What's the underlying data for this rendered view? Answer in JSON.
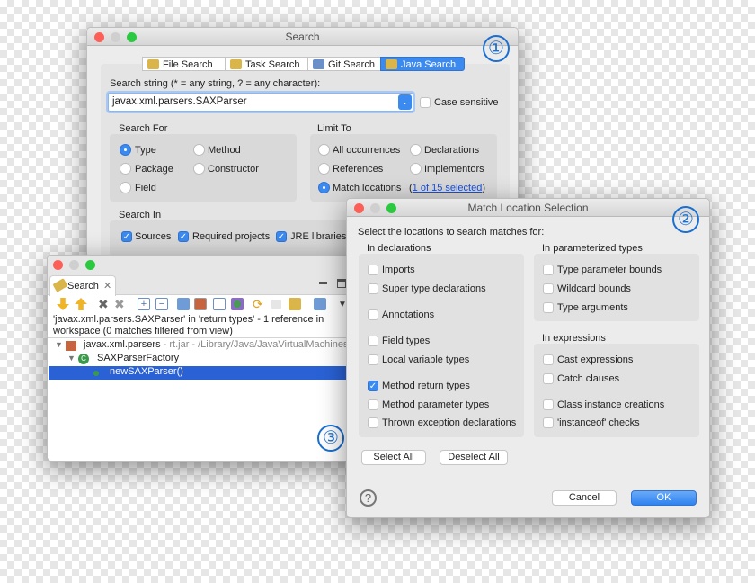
{
  "search_dialog": {
    "title": "Search",
    "badge": "①",
    "tabs": [
      {
        "label": "File Search"
      },
      {
        "label": "Task Search"
      },
      {
        "label": "Git Search"
      },
      {
        "label": "Java Search",
        "active": true
      }
    ],
    "search_string_label": "Search string (* = any string, ? = any character):",
    "search_string_value": "javax.xml.parsers.SAXParser",
    "case_sensitive_label": "Case sensitive",
    "case_sensitive": false,
    "search_for": {
      "label": "Search For",
      "options": [
        "Type",
        "Method",
        "Package",
        "Constructor",
        "Field"
      ],
      "selected": "Type"
    },
    "limit_to": {
      "label": "Limit To",
      "options": [
        "All occurrences",
        "Declarations",
        "References",
        "Implementors",
        "Match locations"
      ],
      "selected": "Match locations",
      "link_open": "(",
      "link": "1 of 15 selected",
      "link_close": ")"
    },
    "search_in": {
      "label": "Search In",
      "options": [
        {
          "label": "Sources",
          "checked": true
        },
        {
          "label": "Required projects",
          "checked": true
        },
        {
          "label": "JRE libraries",
          "checked": true
        }
      ]
    }
  },
  "match_dialog": {
    "title": "Match Location Selection",
    "badge": "②",
    "instruction": "Select the locations to search matches for:",
    "in_declarations": {
      "label": "In declarations",
      "items": [
        {
          "label": "Imports",
          "checked": false
        },
        {
          "label": "Super type declarations",
          "checked": false
        },
        {
          "label": "Annotations",
          "checked": false
        },
        {
          "label": "Field types",
          "checked": false
        },
        {
          "label": "Local variable types",
          "checked": false
        },
        {
          "label": "Method return types",
          "checked": true
        },
        {
          "label": "Method parameter types",
          "checked": false
        },
        {
          "label": "Thrown exception declarations",
          "checked": false
        }
      ]
    },
    "in_parameterized_types": {
      "label": "In parameterized types",
      "items": [
        {
          "label": "Type parameter bounds",
          "checked": false
        },
        {
          "label": "Wildcard bounds",
          "checked": false
        },
        {
          "label": "Type arguments",
          "checked": false
        }
      ]
    },
    "in_expressions": {
      "label": "In expressions",
      "items": [
        {
          "label": "Cast expressions",
          "checked": false
        },
        {
          "label": "Catch clauses",
          "checked": false
        },
        {
          "label": "Class instance creations",
          "checked": false
        },
        {
          "label": "'instanceof' checks",
          "checked": false
        }
      ]
    },
    "select_all": "Select All",
    "deselect_all": "Deselect All",
    "help": "?",
    "cancel": "Cancel",
    "ok": "OK"
  },
  "search_view": {
    "badge": "③",
    "tab_label": "Search",
    "close": "✕",
    "message_line1": "'javax.xml.parsers.SAXParser' in 'return types' - 1 reference in",
    "message_line2": "workspace (0 matches filtered from view)",
    "tree": [
      {
        "label": "javax.xml.parsers",
        "detail": " - rt.jar - /Library/Java/JavaVirtualMachines/jc"
      },
      {
        "label": "SAXParserFactory"
      },
      {
        "label": "newSAXParser()",
        "selected": true
      }
    ]
  },
  "colors": {
    "accent": "#3b8af0",
    "selection": "#2a62d6",
    "badge": "#1a6fd0",
    "link": "#1a4fd6"
  }
}
